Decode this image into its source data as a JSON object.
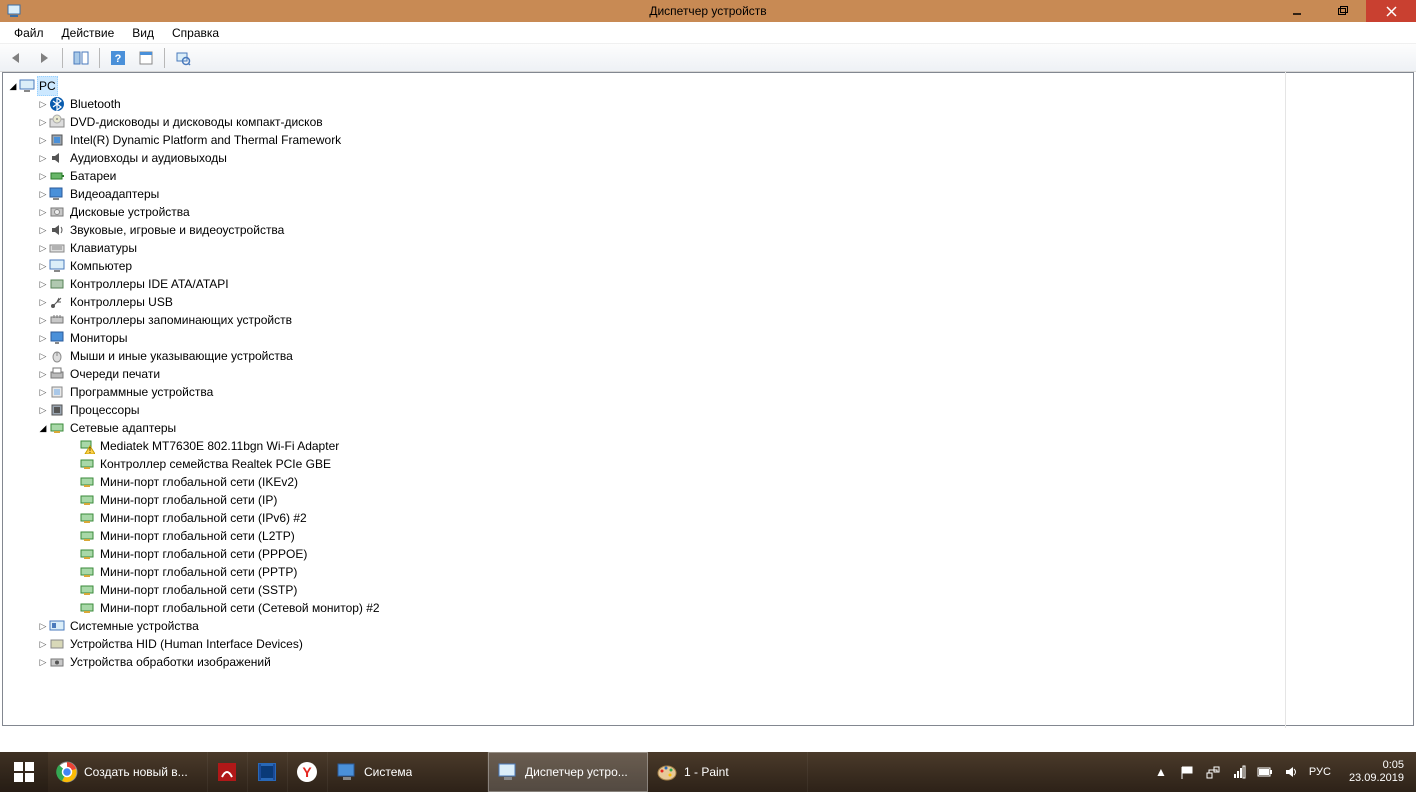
{
  "window": {
    "title": "Диспетчер устройств"
  },
  "menu": {
    "file": "Файл",
    "action": "Действие",
    "view": "Вид",
    "help": "Справка"
  },
  "tree": {
    "root": "PC",
    "cats": {
      "bluetooth": "Bluetooth",
      "dvd": "DVD-дисководы и дисководы компакт-дисков",
      "intel_dptf": "Intel(R) Dynamic Platform and Thermal Framework",
      "audio_io": "Аудиовходы и аудиовыходы",
      "batteries": "Батареи",
      "video": "Видеоадаптеры",
      "disks": "Дисковые устройства",
      "sound": "Звуковые, игровые и видеоустройства",
      "keyboards": "Клавиатуры",
      "computer": "Компьютер",
      "ide": "Контроллеры IDE ATA/ATAPI",
      "usb": "Контроллеры USB",
      "storage_ctrl": "Контроллеры запоминающих устройств",
      "monitors": "Мониторы",
      "mice": "Мыши и иные указывающие устройства",
      "print_queues": "Очереди печати",
      "software": "Программные устройства",
      "cpu": "Процессоры",
      "net": "Сетевые адаптеры",
      "system": "Системные устройства",
      "hid": "Устройства HID (Human Interface Devices)",
      "imaging": "Устройства обработки изображений"
    },
    "net_items": {
      "n0": "Mediatek MT7630E 802.11bgn Wi-Fi Adapter",
      "n1": "Контроллер семейства Realtek PCIe GBE",
      "n2": "Мини-порт глобальной сети (IKEv2)",
      "n3": "Мини-порт глобальной сети (IP)",
      "n4": "Мини-порт глобальной сети (IPv6) #2",
      "n5": "Мини-порт глобальной сети (L2TP)",
      "n6": "Мини-порт глобальной сети (PPPOE)",
      "n7": "Мини-порт глобальной сети (PPTP)",
      "n8": "Мини-порт глобальной сети (SSTP)",
      "n9": "Мини-порт глобальной сети (Сетевой монитор) #2"
    }
  },
  "taskbar": {
    "items": {
      "chrome": "Создать новый в...",
      "system": "Система",
      "devmgr": "Диспетчер устро...",
      "paint": "1 - Paint"
    },
    "lang": "РУС",
    "time": "0:05",
    "date": "23.09.2019"
  }
}
